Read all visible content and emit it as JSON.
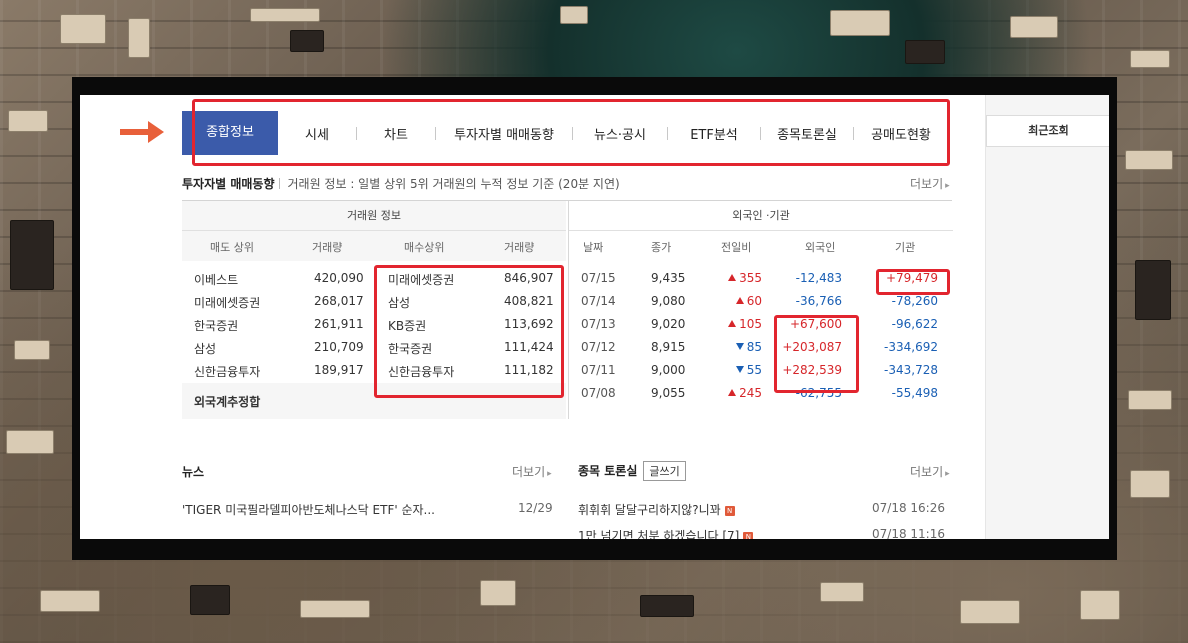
{
  "nav": {
    "tabs": [
      "종합정보",
      "시세",
      "차트",
      "투자자별 매매동향",
      "뉴스·공시",
      "ETF분석",
      "종목토론실",
      "공매도현황"
    ],
    "active_index": 0
  },
  "sidebar": {
    "recent_label": "최근조회"
  },
  "investor": {
    "title": "투자자별 매매동향",
    "desc": "거래원 정보 : 일별 상위 5위 거래원의 누적 정보 기준 (20분 지연)",
    "more": "더보기",
    "broker_header": "거래원 정보",
    "foreign_header": "외국인 ·기관",
    "col_sell": "매도 상위",
    "col_sell_vol": "거래량",
    "col_buy": "매수상위",
    "col_buy_vol": "거래량",
    "col_date": "날짜",
    "col_close": "종가",
    "col_change": "전일비",
    "col_foreign": "외국인",
    "col_inst": "기관",
    "sell_rows": [
      {
        "name": "이베스트",
        "vol": "420,090"
      },
      {
        "name": "미래에셋증권",
        "vol": "268,017"
      },
      {
        "name": "한국증권",
        "vol": "261,911"
      },
      {
        "name": "삼성",
        "vol": "210,709"
      },
      {
        "name": "신한금융투자",
        "vol": "189,917"
      }
    ],
    "buy_rows": [
      {
        "name": "미래에셋증권",
        "vol": "846,907"
      },
      {
        "name": "삼성",
        "vol": "408,821"
      },
      {
        "name": "KB증권",
        "vol": "113,692"
      },
      {
        "name": "한국증권",
        "vol": "111,424"
      },
      {
        "name": "신한금융투자",
        "vol": "111,182"
      }
    ],
    "foreign_total_label": "외국계추정합",
    "daily_rows": [
      {
        "date": "07/15",
        "close": "9,435",
        "dir": "up",
        "change": "355",
        "foreign": "-12,483",
        "inst": "+79,479"
      },
      {
        "date": "07/14",
        "close": "9,080",
        "dir": "up",
        "change": "60",
        "foreign": "-36,766",
        "inst": "-78,260"
      },
      {
        "date": "07/13",
        "close": "9,020",
        "dir": "up",
        "change": "105",
        "foreign": "+67,600",
        "inst": "-96,622"
      },
      {
        "date": "07/12",
        "close": "8,915",
        "dir": "down",
        "change": "85",
        "foreign": "+203,087",
        "inst": "-334,692"
      },
      {
        "date": "07/11",
        "close": "9,000",
        "dir": "down",
        "change": "55",
        "foreign": "+282,539",
        "inst": "-343,728"
      },
      {
        "date": "07/08",
        "close": "9,055",
        "dir": "up",
        "change": "245",
        "foreign": "-62,755",
        "inst": "-55,498"
      }
    ]
  },
  "news": {
    "title": "뉴스",
    "more": "더보기",
    "items": [
      {
        "text": "'TIGER 미국필라델피아반도체나스닥 ETF' 순자...",
        "date": "12/29"
      }
    ]
  },
  "board": {
    "title": "종목 토론실",
    "write_label": "글쓰기",
    "more": "더보기",
    "new_badge": "N",
    "items": [
      {
        "text": "휘휘휘 달달구리하지않?니꽈",
        "date": "07/18 16:26"
      },
      {
        "text": "1만 넘기면 처분 하겠습니다 [7]",
        "date": "07/18 11:16"
      }
    ]
  },
  "colors": {
    "accent": "#3b5baa",
    "highlight": "#e2252f",
    "arrow": "#e8603a",
    "up": "#d6262a",
    "down": "#1a5fb4"
  }
}
